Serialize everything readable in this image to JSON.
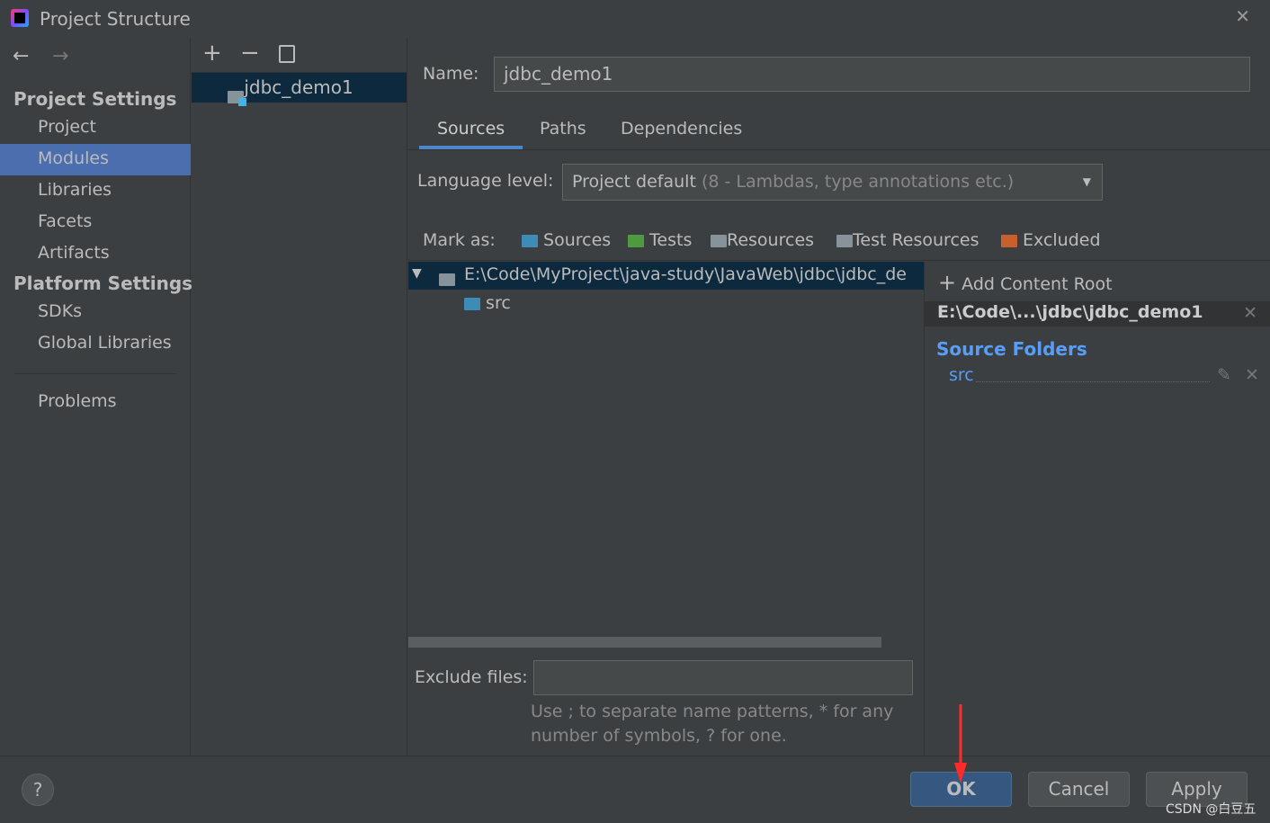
{
  "window": {
    "title": "Project Structure",
    "close_icon": "close-icon"
  },
  "sidebar": {
    "back": "←",
    "forward": "→",
    "project_settings": "Project Settings",
    "project_items": [
      "Project",
      "Modules",
      "Libraries",
      "Facets",
      "Artifacts"
    ],
    "platform_settings": "Platform Settings",
    "platform_items": [
      "SDKs",
      "Global Libraries"
    ],
    "problems": "Problems",
    "selected": "Modules"
  },
  "modules": {
    "add": "+",
    "remove": "−",
    "copy_icon": "copy-icon",
    "items": [
      "jdbc_demo1"
    ]
  },
  "main": {
    "name_label": "Name:",
    "name_value": "jdbc_demo1",
    "tabs": [
      "Sources",
      "Paths",
      "Dependencies"
    ],
    "active_tab": "Sources",
    "language_label": "Language level:",
    "language_value": "Project default",
    "language_hint": "(8 - Lambdas, type annotations etc.)",
    "mark_as": "Mark as:",
    "marks": [
      {
        "label": "Sources",
        "color": "#3d8cb5"
      },
      {
        "label": "Tests",
        "color": "#4e9a3f"
      },
      {
        "label": "Resources",
        "color": "#87939a"
      },
      {
        "label": "Test Resources",
        "color": "#87939a"
      },
      {
        "label": "Excluded",
        "color": "#c8602b"
      }
    ],
    "tree": {
      "root": "E:\\Code\\MyProject\\java-study\\JavaWeb\\jdbc\\jdbc_de",
      "child": "src"
    },
    "exclude_label": "Exclude files:",
    "exclude_value": "",
    "exclude_hint_1": "Use ; to separate name patterns, * for any",
    "exclude_hint_2": "number of symbols, ? for one."
  },
  "content_root": {
    "add": "Add Content Root",
    "root_path": "E:\\Code\\...\\jdbc\\jdbc_demo1",
    "source_folders": "Source Folders",
    "source_item": "src",
    "accent": "#589df6"
  },
  "footer": {
    "help": "?",
    "ok": "OK",
    "cancel": "Cancel",
    "apply": "Apply",
    "watermark": "CSDN @白豆五"
  }
}
